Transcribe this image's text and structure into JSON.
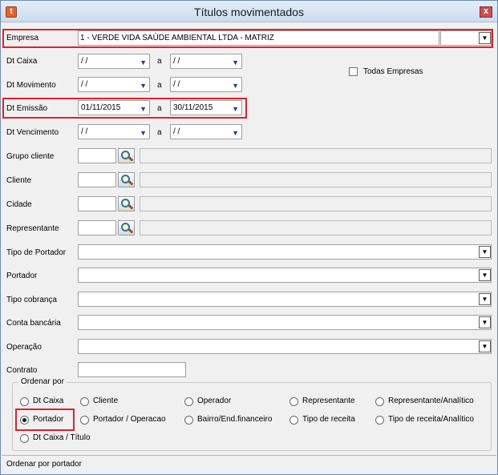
{
  "window": {
    "title": "Títulos movimentados",
    "app_icon_glyph": "t",
    "close_glyph": "x"
  },
  "empresa": {
    "label": "Empresa",
    "value": "1 - VERDE VIDA SAÚDE AMBIENTAL LTDA - MATRIZ"
  },
  "dates": {
    "separator": "a",
    "dt_caixa": {
      "label": "Dt Caixa",
      "from": "/ /",
      "to": "/ /"
    },
    "dt_movimento": {
      "label": "Dt Movimento",
      "from": "/ /",
      "to": "/ /"
    },
    "dt_emissao": {
      "label": "Dt Emissão",
      "from": "01/11/2015",
      "to": "30/11/2015"
    },
    "dt_vencimento": {
      "label": "Dt Vencimento",
      "from": "/ /",
      "to": "/ /"
    }
  },
  "todas_empresas": {
    "label": "Todas Empresas",
    "checked": false
  },
  "lookups": [
    {
      "label": "Grupo cliente"
    },
    {
      "label": "Cliente"
    },
    {
      "label": "Cidade"
    },
    {
      "label": "Representante"
    }
  ],
  "combos": [
    {
      "label": "Tipo de Portador",
      "value": ""
    },
    {
      "label": "Portador",
      "value": ""
    },
    {
      "label": "Tipo cobrança",
      "value": ""
    },
    {
      "label": "Conta bancária",
      "value": ""
    },
    {
      "label": "Operação",
      "value": ""
    }
  ],
  "contrato": {
    "label": "Contrato",
    "value": ""
  },
  "ordenar": {
    "legend": "Ordenar por",
    "selected": "Portador",
    "options": [
      "Dt Caixa",
      "Cliente",
      "Operador",
      "Representante",
      "Representante/Analítico",
      "Portador",
      "Portador / Operacao",
      "Bairro/End.financeiro",
      "Tipo de receita",
      "Tipo de receita/Analítico",
      "Dt Caixa / Título"
    ]
  },
  "status": {
    "text": "Ordenar por portador"
  },
  "icons": {
    "dropdown": "chevron-down-icon",
    "lookup": "magnifier-icon",
    "close": "close-icon"
  },
  "colors": {
    "highlight": "#e0202a",
    "titlebar": "#cbdcf0",
    "date_arrow": "#1c3fa8"
  }
}
